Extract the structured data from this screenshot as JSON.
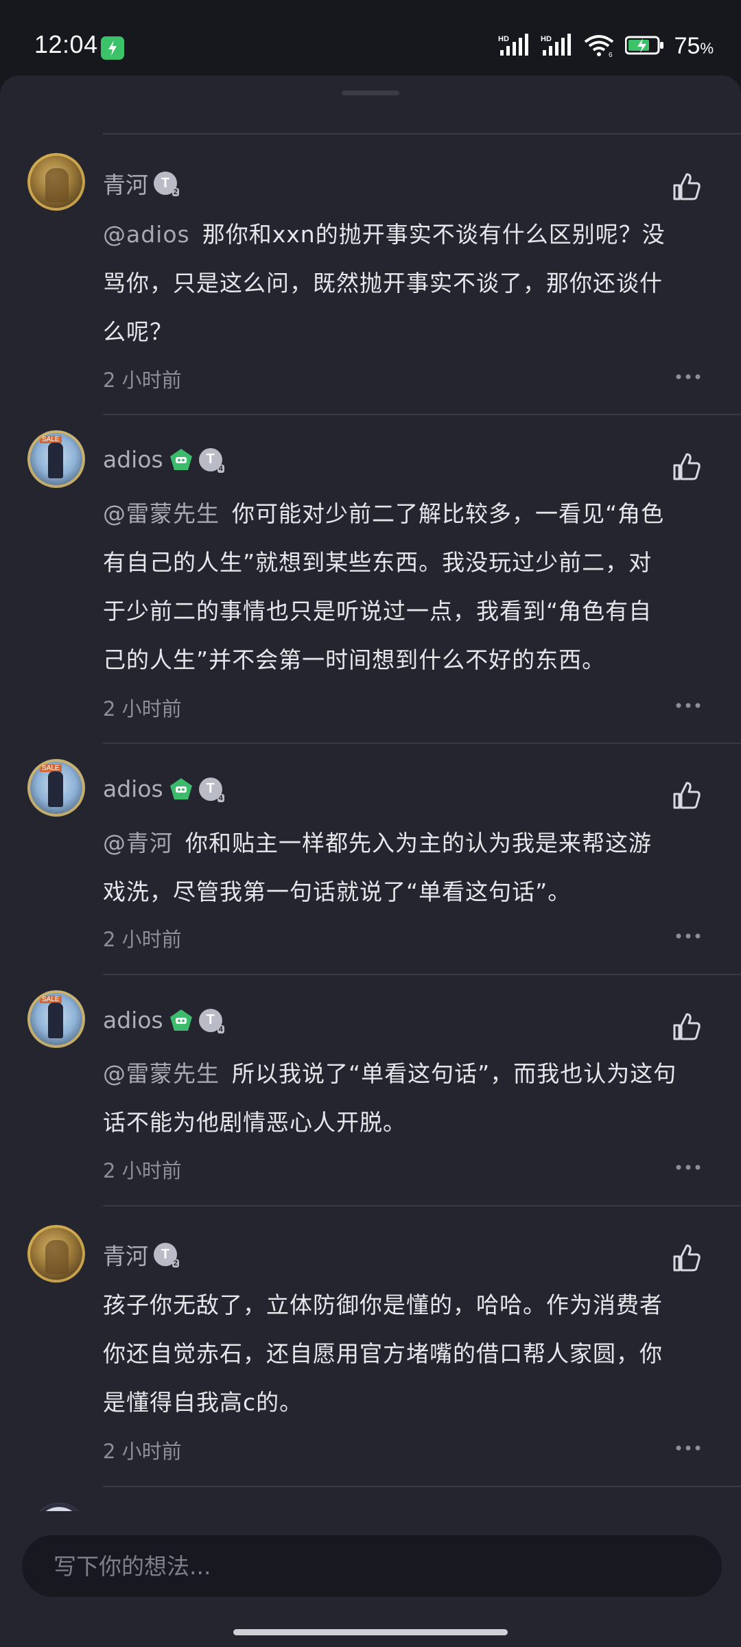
{
  "status_bar": {
    "time": "12:04",
    "network_1": "HD",
    "network_2": "HD",
    "wifi_label": "6",
    "battery_percent": "75",
    "battery_unit": "%"
  },
  "comments": [
    {
      "author": "青河",
      "avatar": "golden-figure-avatar",
      "badges": [
        "level-badge"
      ],
      "mention": "@adios",
      "lines": [
        "那你和xxn的抛开事实不谈有什么区别呢？没",
        "骂你，只是这么问，既然抛开事实不谈了，那你还谈什",
        "么呢？"
      ],
      "time": "2 小时前"
    },
    {
      "author": "adios",
      "avatar": "anime-character-avatar",
      "badges": [
        "green-game-badge",
        "level-badge"
      ],
      "mention": "@雷蒙先生",
      "lines": [
        "你可能对少前二了解比较多，一看见“角色",
        "有自己的人生”就想到某些东西。我没玩过少前二，对",
        "于少前二的事情也只是听说过一点，我看到“角色有自",
        "己的人生”并不会第一时间想到什么不好的东西。"
      ],
      "time": "2 小时前"
    },
    {
      "author": "adios",
      "avatar": "anime-character-avatar",
      "badges": [
        "green-game-badge",
        "level-badge"
      ],
      "mention": "@青河",
      "lines": [
        "你和贴主一样都先入为主的认为我是来帮这游",
        "戏洗，尽管我第一句话就说了“单看这句话”。"
      ],
      "time": "2 小时前"
    },
    {
      "author": "adios",
      "avatar": "anime-character-avatar",
      "badges": [
        "green-game-badge",
        "level-badge"
      ],
      "mention": "@雷蒙先生",
      "lines": [
        "所以我说了“单看这句话”，而我也认为这句",
        "话不能为他剧情恶心人开脱。"
      ],
      "time": "2 小时前"
    },
    {
      "author": "青河",
      "avatar": "golden-figure-avatar",
      "badges": [
        "level-badge"
      ],
      "mention": "",
      "lines": [
        "孩子你无敌了，立体防御你是懂的，哈哈。作为消费者",
        "你还自觉赤石，还自愿用官方堵嘴的借口帮人家圆，你",
        "是懂得自我高c的。"
      ],
      "time": "2 小时前"
    }
  ],
  "composer": {
    "placeholder": "写下你的想法..."
  },
  "icons": {
    "like": "thumbs-up-icon",
    "more": "more-dots-icon",
    "charging": "lightning-icon"
  }
}
